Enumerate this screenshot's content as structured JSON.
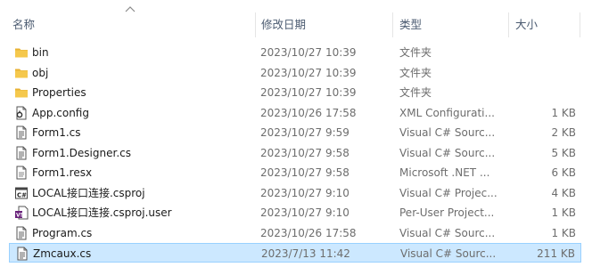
{
  "columns": {
    "name": "名称",
    "date": "修改日期",
    "type": "类型",
    "size": "大小"
  },
  "files": [
    {
      "name": "bin",
      "date": "2023/10/27 10:39",
      "type": "文件夹",
      "size": "",
      "icon": "folder-icon"
    },
    {
      "name": "obj",
      "date": "2023/10/27 10:39",
      "type": "文件夹",
      "size": "",
      "icon": "folder-icon"
    },
    {
      "name": "Properties",
      "date": "2023/10/27 10:39",
      "type": "文件夹",
      "size": "",
      "icon": "folder-icon"
    },
    {
      "name": "App.config",
      "date": "2023/10/26 17:58",
      "type": "XML Configurati...",
      "size": "1 KB",
      "icon": "config-file-icon"
    },
    {
      "name": "Form1.cs",
      "date": "2023/10/27 9:59",
      "type": "Visual C# Sourc...",
      "size": "2 KB",
      "icon": "cs-file-icon"
    },
    {
      "name": "Form1.Designer.cs",
      "date": "2023/10/27 9:58",
      "type": "Visual C# Sourc...",
      "size": "5 KB",
      "icon": "cs-file-icon"
    },
    {
      "name": "Form1.resx",
      "date": "2023/10/27 9:58",
      "type": "Microsoft .NET ...",
      "size": "6 KB",
      "icon": "resx-file-icon"
    },
    {
      "name": "LOCAL接口连接.csproj",
      "date": "2023/10/27 9:10",
      "type": "Visual C# Projec...",
      "size": "4 KB",
      "icon": "csproj-file-icon"
    },
    {
      "name": "LOCAL接口连接.csproj.user",
      "date": "2023/10/27 9:10",
      "type": "Per-User Project...",
      "size": "1 KB",
      "icon": "csproj-user-file-icon"
    },
    {
      "name": "Program.cs",
      "date": "2023/10/26 17:58",
      "type": "Visual C# Sourc...",
      "size": "1 KB",
      "icon": "cs-file-icon"
    },
    {
      "name": "Zmcaux.cs",
      "date": "2023/7/13 11:42",
      "type": "Visual C# Sourc...",
      "size": "211 KB",
      "icon": "cs-file-icon",
      "selected": true
    }
  ],
  "colors": {
    "selection_bg": "#cce8ff",
    "selection_border": "#99d1ff",
    "folder": "#f5c84c",
    "header_text": "#4a5a70"
  }
}
